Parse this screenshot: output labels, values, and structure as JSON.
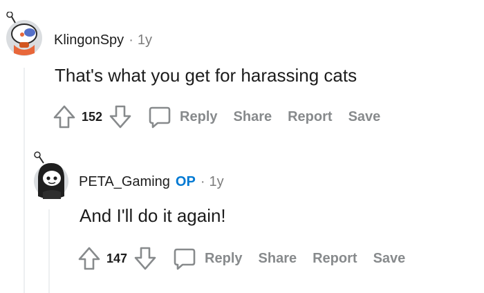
{
  "comments": [
    {
      "username": "KlingonSpy",
      "is_op": false,
      "age": "1y",
      "body": "That's what you get for harassing cats",
      "score": "152",
      "actions": {
        "reply": "Reply",
        "share": "Share",
        "report": "Report",
        "save": "Save"
      }
    },
    {
      "username": "PETA_Gaming",
      "is_op": true,
      "op_label": "OP",
      "age": "1y",
      "body": "And I'll do it again!",
      "score": "147",
      "actions": {
        "reply": "Reply",
        "share": "Share",
        "report": "Report",
        "save": "Save"
      }
    }
  ],
  "meta_separator": "·",
  "colors": {
    "op": "#0079d3",
    "muted": "#878a8c",
    "thread_line": "#edeff1"
  },
  "icons": [
    "upvote-icon",
    "downvote-icon",
    "reply-bubble-icon",
    "snoo-avatar"
  ]
}
